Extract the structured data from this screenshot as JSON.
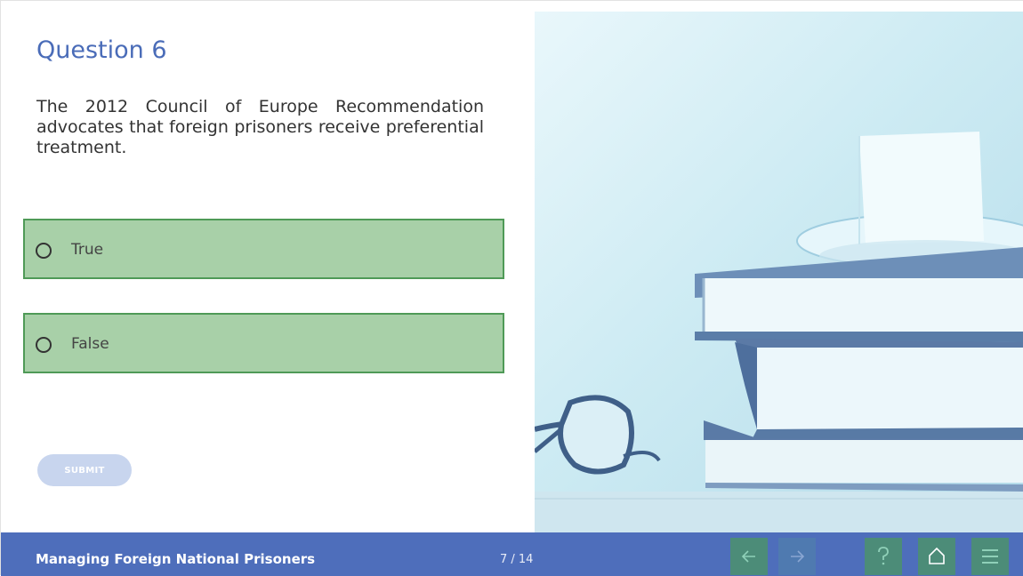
{
  "question": {
    "title": "Question 6",
    "text": "The 2012 Council of Europe Recommendation advocates that foreign prisoners receive preferential treatment."
  },
  "options": [
    {
      "label": "True"
    },
    {
      "label": "False"
    }
  ],
  "submit_label": "SUBMIT",
  "footer": {
    "course_title": "Managing Foreign National Prisoners",
    "page_counter": "7 / 14"
  },
  "icons": {
    "back": "arrow-left-icon",
    "forward": "arrow-right-icon",
    "help": "question-mark-icon",
    "home": "home-icon",
    "menu": "hamburger-menu-icon"
  },
  "colors": {
    "accent": "#4a6cb8",
    "footer_bg": "#4e6ebb",
    "option_bg": "#a8d0a8",
    "option_border": "#4f9a57",
    "nav_button_bg": "#4c8c78"
  }
}
